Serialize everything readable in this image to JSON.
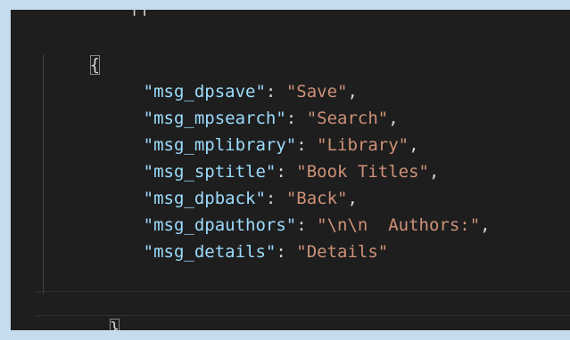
{
  "editor": {
    "partial_line": "  ||",
    "open_brace": "{",
    "close_brace": "}",
    "lines": [
      {
        "key": "\"msg_dpsave\"",
        "sep": ": ",
        "value": "\"Save\"",
        "trail": ","
      },
      {
        "key": "\"msg_mpsearch\"",
        "sep": ": ",
        "value": "\"Search\"",
        "trail": ","
      },
      {
        "key": "\"msg_mplibrary\"",
        "sep": ": ",
        "value": "\"Library\"",
        "trail": ","
      },
      {
        "key": "\"msg_sptitle\"",
        "sep": ": ",
        "value": "\"Book Titles\"",
        "trail": ","
      },
      {
        "key": "\"msg_dpback\"",
        "sep": ": ",
        "value": "\"Back\"",
        "trail": ","
      },
      {
        "key": "\"msg_dpauthors\"",
        "sep": ": ",
        "value": "\"\\n\\n  Authors:\"",
        "trail": ","
      },
      {
        "key": "\"msg_details\"",
        "sep": ": ",
        "value": "\"Details\"",
        "trail": ""
      }
    ]
  }
}
